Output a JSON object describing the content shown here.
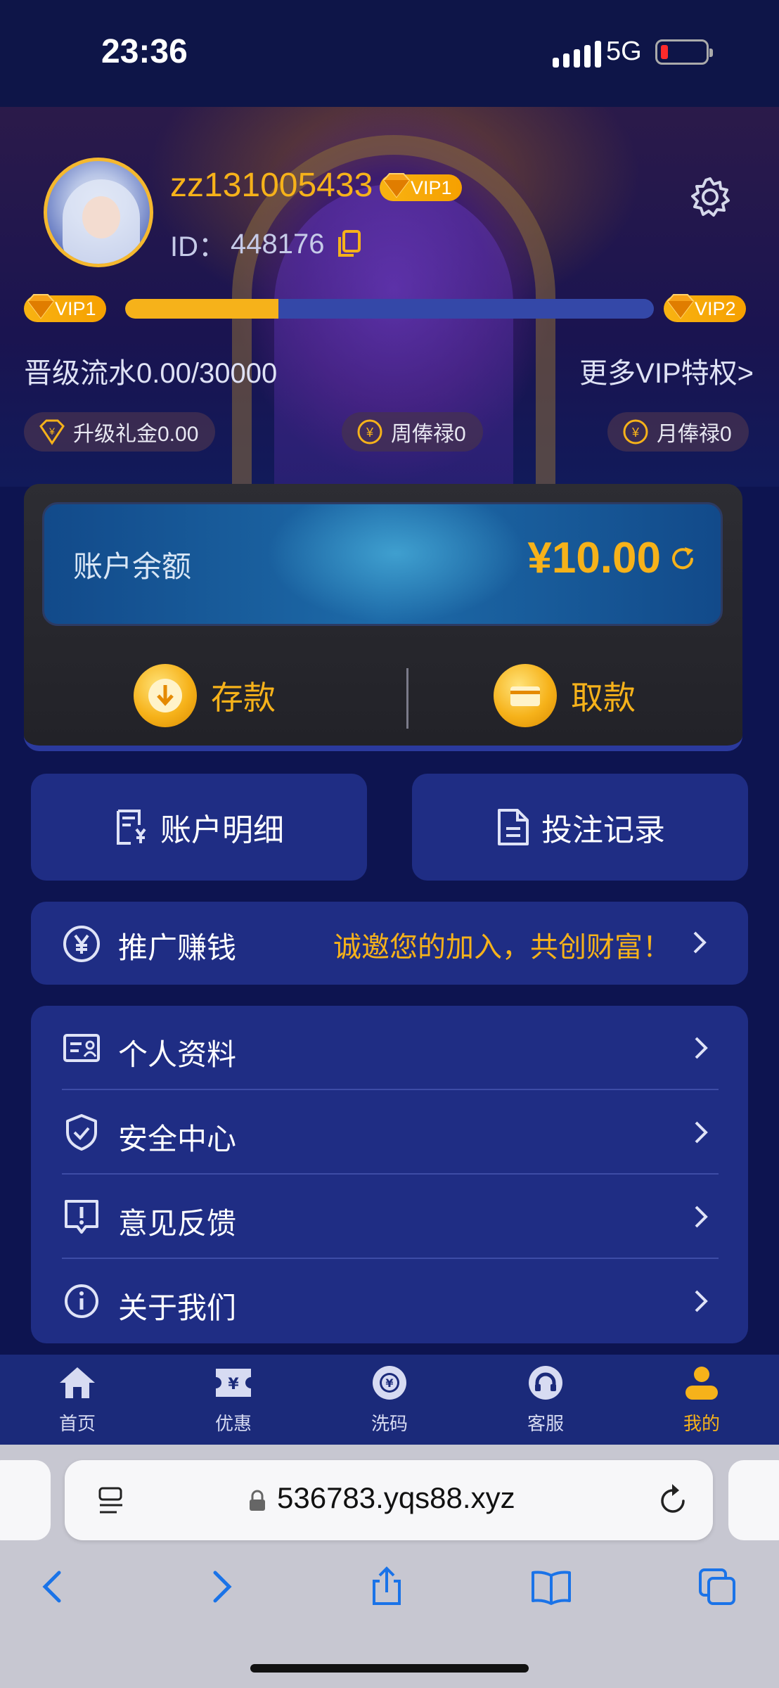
{
  "status": {
    "time": "23:36",
    "network": "5G"
  },
  "profile": {
    "username": "zz131005433",
    "vip_level": "VIP1",
    "id_label": "ID：",
    "id_value": "448176"
  },
  "vip_progress": {
    "current": "VIP1",
    "next": "VIP2",
    "progress_fraction": 0.29,
    "turnover_text": "晋级流水0.00/30000",
    "more_link": "更多VIP特权>"
  },
  "perks": [
    {
      "label": "升级礼金0.00",
      "icon": "diamond-icon"
    },
    {
      "label": "周俸禄0",
      "icon": "yen-coin-icon"
    },
    {
      "label": "月俸禄0",
      "icon": "yen-coin-icon"
    }
  ],
  "balance": {
    "label": "账户余额",
    "amount": "¥10.00"
  },
  "actions": {
    "deposit": "存款",
    "withdraw": "取款"
  },
  "quick": {
    "account_details": "账户明细",
    "bet_records": "投注记录"
  },
  "promo": {
    "label": "推广赚钱",
    "slogan": "诚邀您的加入，共创财富！"
  },
  "menu": [
    {
      "label": "个人资料",
      "icon": "id-card-icon"
    },
    {
      "label": "安全中心",
      "icon": "shield-icon"
    },
    {
      "label": "意见反馈",
      "icon": "feedback-icon"
    },
    {
      "label": "关于我们",
      "icon": "info-icon"
    }
  ],
  "tabs": [
    {
      "label": "首页",
      "icon": "home-icon"
    },
    {
      "label": "优惠",
      "icon": "ticket-icon"
    },
    {
      "label": "洗码",
      "icon": "chip-icon"
    },
    {
      "label": "客服",
      "icon": "headset-icon"
    },
    {
      "label": "我的",
      "icon": "user-icon",
      "active": true
    }
  ],
  "browser": {
    "url": "536783.yqs88.xyz"
  },
  "colors": {
    "accent": "#f6b21a",
    "card": "#1f2d84",
    "background": "#0d1450"
  }
}
